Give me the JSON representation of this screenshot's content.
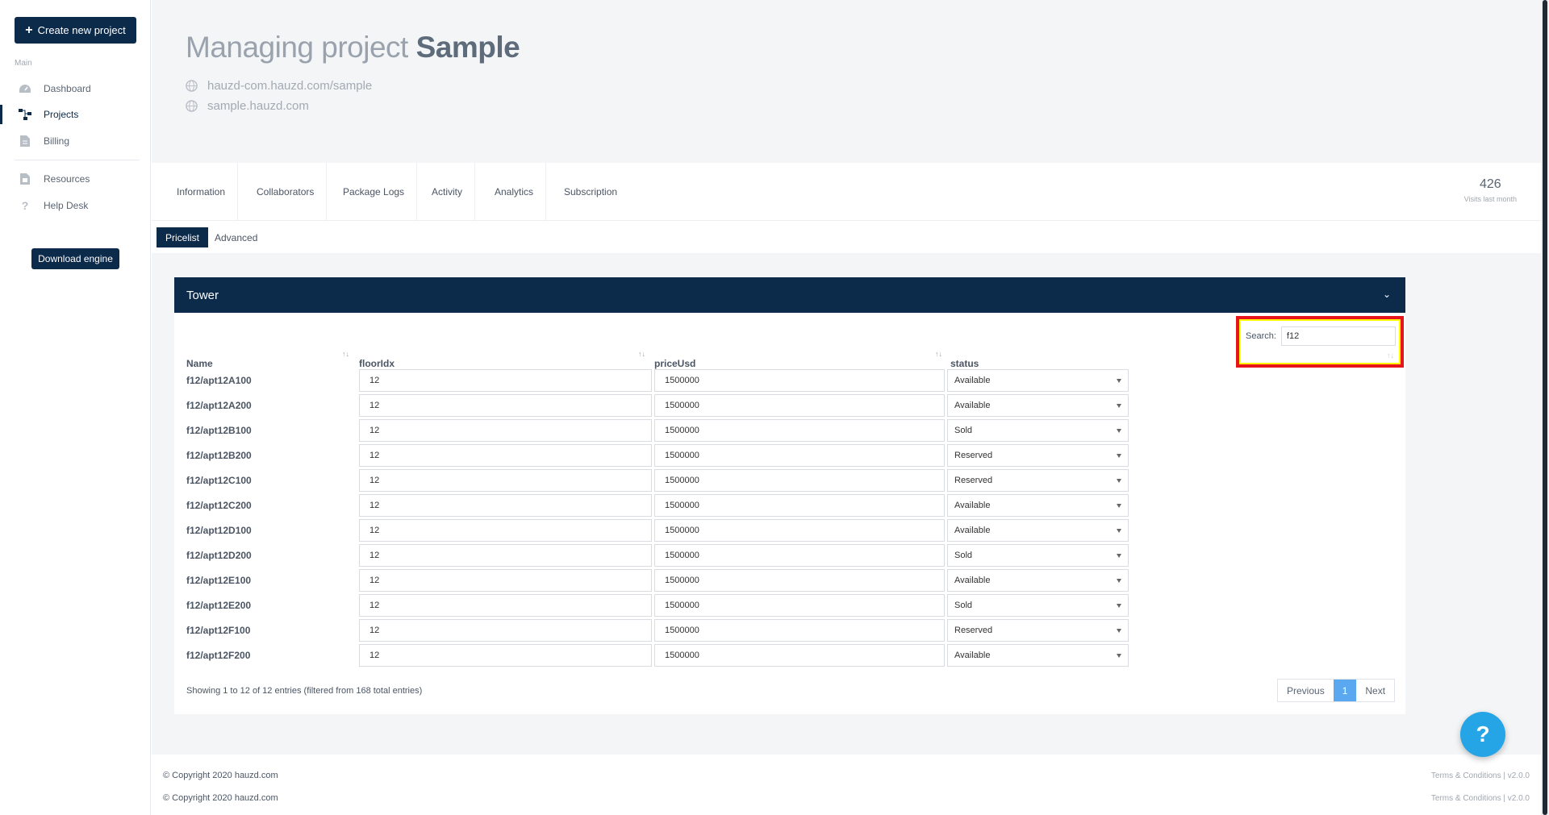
{
  "sidebar": {
    "create_label": "Create new project",
    "section_label": "Main",
    "items": [
      {
        "label": "Dashboard",
        "icon": "dashboard-icon"
      },
      {
        "label": "Projects",
        "icon": "projects-icon"
      },
      {
        "label": "Billing",
        "icon": "billing-icon"
      },
      {
        "label": "Resources",
        "icon": "resources-icon"
      },
      {
        "label": "Help Desk",
        "icon": "help-icon"
      }
    ],
    "download_label": "Download engine"
  },
  "header": {
    "title_prefix": "Managing project",
    "title_name": "Sample",
    "urls": [
      "hauzd-com.hauzd.com/sample",
      "sample.hauzd.com"
    ]
  },
  "tabs": [
    "Information",
    "Collaborators",
    "Package Logs",
    "Activity",
    "Analytics",
    "Subscription"
  ],
  "visits": {
    "value": "426",
    "label": "Visits last month"
  },
  "subtabs": {
    "active": "Pricelist",
    "other": "Advanced"
  },
  "panel": {
    "title": "Tower",
    "search_label": "Search:",
    "search_value": "f12",
    "columns": [
      "Name",
      "floorIdx",
      "priceUsd",
      "status"
    ],
    "rows": [
      {
        "name": "f12/apt12A100",
        "floor": "12",
        "price": "1500000",
        "status": "Available"
      },
      {
        "name": "f12/apt12A200",
        "floor": "12",
        "price": "1500000",
        "status": "Available"
      },
      {
        "name": "f12/apt12B100",
        "floor": "12",
        "price": "1500000",
        "status": "Sold"
      },
      {
        "name": "f12/apt12B200",
        "floor": "12",
        "price": "1500000",
        "status": "Reserved"
      },
      {
        "name": "f12/apt12C100",
        "floor": "12",
        "price": "1500000",
        "status": "Reserved"
      },
      {
        "name": "f12/apt12C200",
        "floor": "12",
        "price": "1500000",
        "status": "Available"
      },
      {
        "name": "f12/apt12D100",
        "floor": "12",
        "price": "1500000",
        "status": "Available"
      },
      {
        "name": "f12/apt12D200",
        "floor": "12",
        "price": "1500000",
        "status": "Sold"
      },
      {
        "name": "f12/apt12E100",
        "floor": "12",
        "price": "1500000",
        "status": "Available"
      },
      {
        "name": "f12/apt12E200",
        "floor": "12",
        "price": "1500000",
        "status": "Sold"
      },
      {
        "name": "f12/apt12F100",
        "floor": "12",
        "price": "1500000",
        "status": "Reserved"
      },
      {
        "name": "f12/apt12F200",
        "floor": "12",
        "price": "1500000",
        "status": "Available"
      }
    ],
    "info": "Showing 1 to 12 of 12 entries (filtered from 168 total entries)",
    "pager": {
      "prev": "Previous",
      "current": "1",
      "next": "Next"
    }
  },
  "footer": {
    "copyright": "© Copyright 2020 hauzd.com",
    "terms": "Terms & Conditions | v2.0.0"
  },
  "help_label": "?",
  "colors": {
    "brand": "#0c2a4a",
    "accent": "#25a5e6",
    "highlight_border": "#e8141c",
    "highlight_fill": "#ffff00"
  }
}
